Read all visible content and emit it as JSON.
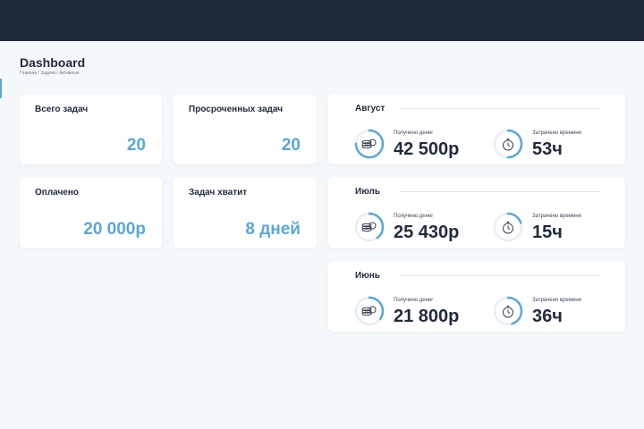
{
  "page": {
    "title": "Dashboard",
    "breadcrumb": "Главная / Задачи / Активные"
  },
  "stats": [
    {
      "label": "Всего задач",
      "value": "20"
    },
    {
      "label": "Просроченных задач",
      "value": "20"
    },
    {
      "label": "Оплачено",
      "value": "20 000р"
    },
    {
      "label": "Задач хватит",
      "value": "8 дней"
    }
  ],
  "months": [
    {
      "name": "Август",
      "money_label": "Получено денег",
      "money": "42 500р",
      "time_label": "Затрачено времени",
      "time": "53ч",
      "money_ring": 0.75,
      "time_ring": 0.5
    },
    {
      "name": "Июль",
      "money_label": "Получено денег",
      "money": "25 430р",
      "time_label": "Затрачено времени",
      "time": "15ч",
      "money_ring": 0.4,
      "time_ring": 0.2
    },
    {
      "name": "Июнь",
      "money_label": "Получено денег",
      "money": "21 800р",
      "time_label": "Затрачено времени",
      "time": "36ч",
      "money_ring": 0.35,
      "time_ring": 0.45
    }
  ],
  "icons": {
    "money": "coins-icon",
    "time": "stopwatch-icon"
  },
  "colors": {
    "accent": "#5aa7d6",
    "header": "#1f2a3d",
    "background": "#f4f8fa"
  }
}
